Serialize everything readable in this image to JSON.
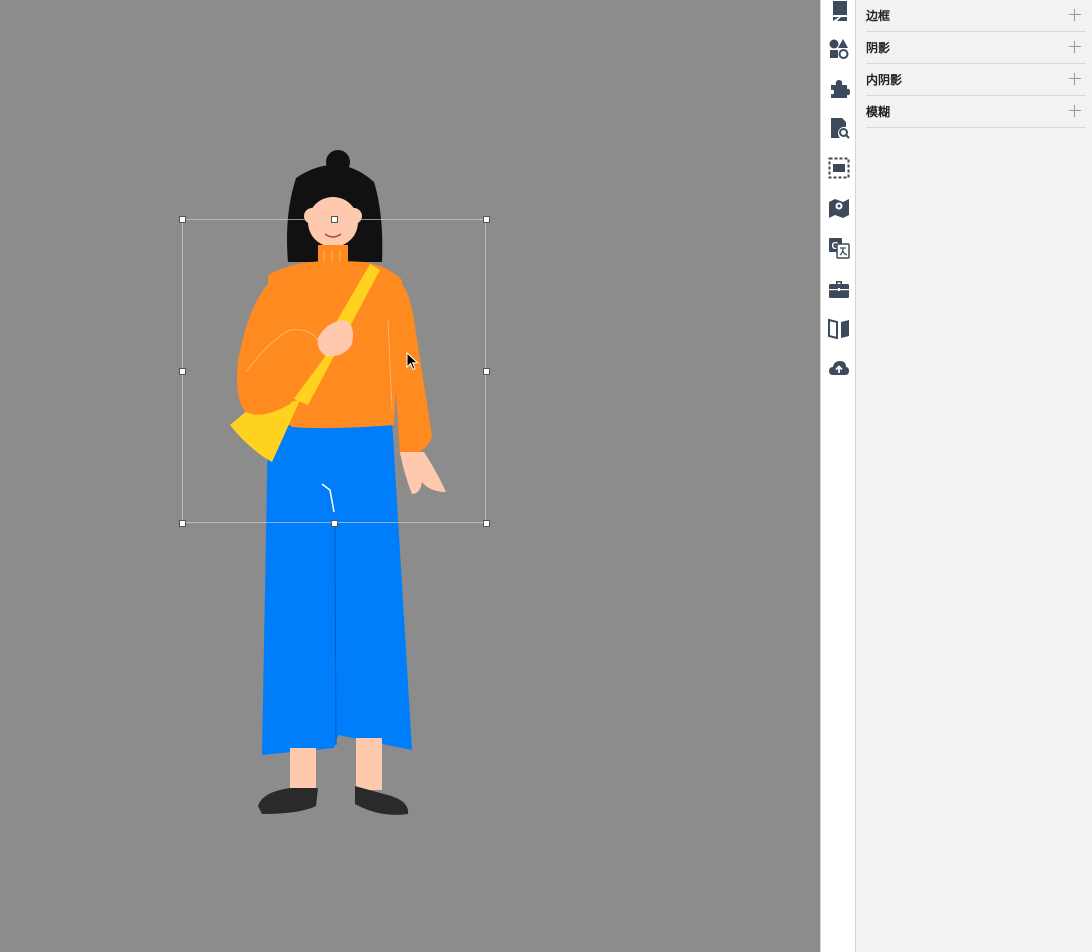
{
  "canvas": {
    "background": "#8c8c8c",
    "illustration": "person-illustration"
  },
  "toolbar": {
    "icons": [
      "style-icon",
      "shapes-icon",
      "plugin-icon",
      "doc-search-icon",
      "frame-select-icon",
      "map-pin-icon",
      "translate-icon",
      "toolbox-icon",
      "book-icon",
      "cloud-upload-icon"
    ]
  },
  "panel": {
    "sections": [
      {
        "label": "边框"
      },
      {
        "label": "阴影"
      },
      {
        "label": "内阴影"
      },
      {
        "label": "模糊"
      }
    ]
  },
  "colors": {
    "hair": "#111111",
    "skin": "#ffc9ae",
    "sweater": "#ff8a1f",
    "bag": "#ffd21f",
    "pants": "#007dfa",
    "shoes": "#2a2a2a",
    "icon": "#3c4a5c"
  }
}
